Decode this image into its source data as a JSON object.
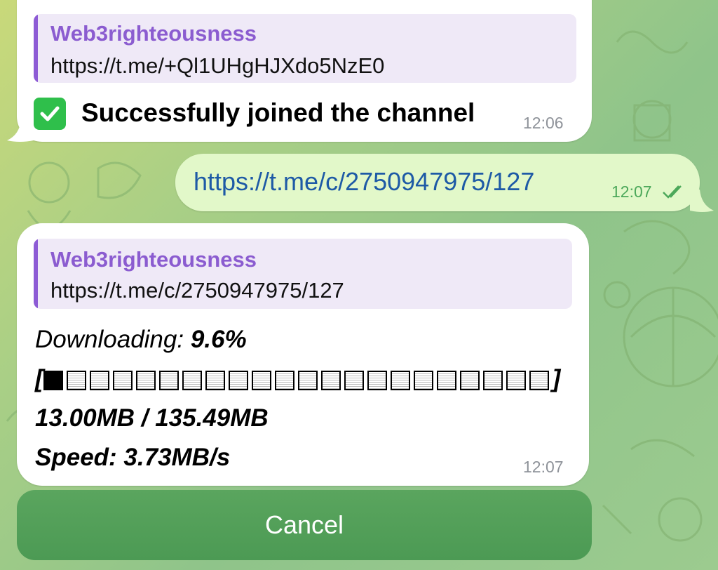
{
  "messages": [
    {
      "quote_title": "Web3righteousness",
      "quote_link": "https://t.me/+Ql1UHgHJXdo5NzE0",
      "text": "Successfully joined the channel",
      "time": "12:06"
    },
    {
      "text": "https://t.me/c/2750947975/127",
      "time": "12:07"
    },
    {
      "quote_title": "Web3righteousness",
      "quote_link": "https://t.me/c/2750947975/127",
      "download_label": "Downloading: ",
      "download_percent": "9.6%",
      "progress_fraction": 0.096,
      "progress_open": "[",
      "progress_close": "]",
      "size": "13.00MB / 135.49MB",
      "speed": "Speed: 3.73MB/s",
      "time": "12:07"
    }
  ],
  "cancel_label": "Cancel",
  "colors": {
    "quote_bar": "#8d5bd5",
    "quote_title": "#8b5cd0",
    "outgoing_bubble": "#e2f8c9",
    "link": "#1e5aa6",
    "cancel_button": "#4f9d57",
    "read_check": "#4ca85a"
  },
  "icons": [
    "check-mark-icon",
    "double-check-icon"
  ]
}
